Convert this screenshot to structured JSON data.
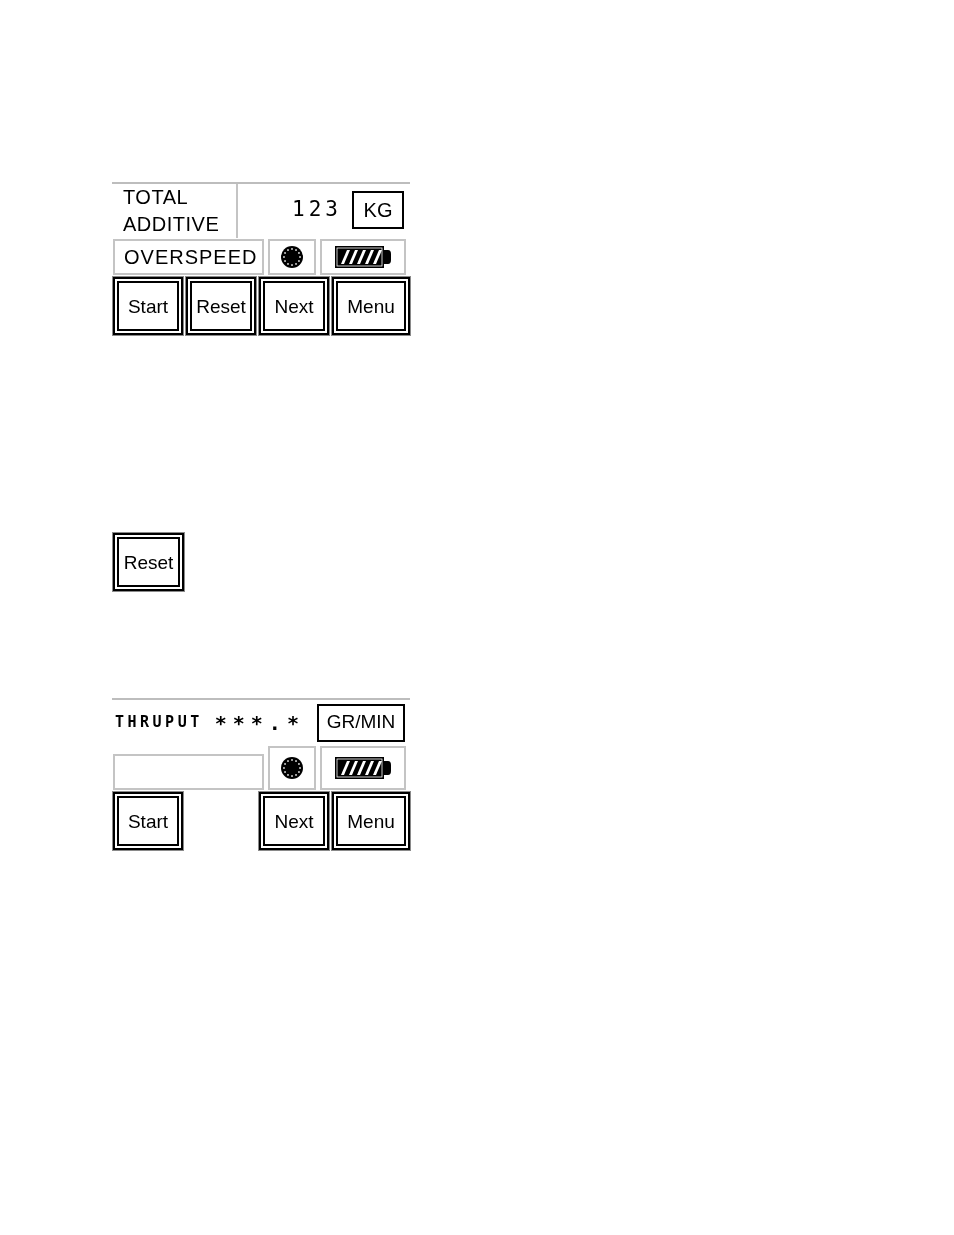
{
  "sections": [
    {
      "kind": "screen",
      "title_boxed": true,
      "title": "TOTAL ADDITIVE",
      "value": "123",
      "unit": "KG",
      "status": "OVERSPEED",
      "buttons": [
        {
          "kind": "button",
          "label": "Start"
        },
        {
          "kind": "button",
          "label": "Reset"
        },
        {
          "kind": "button",
          "label": "Next"
        },
        {
          "kind": "button",
          "label": "Menu"
        }
      ]
    },
    {
      "kind": "button",
      "label": "Reset"
    },
    {
      "kind": "screen",
      "title_boxed": false,
      "title": "THRUPUT",
      "value": "***.*",
      "unit": "GR/MIN",
      "buttons": [
        {
          "kind": "button",
          "label": "Start"
        },
        {
          "kind": "blank"
        },
        {
          "kind": "button",
          "label": "Next"
        },
        {
          "kind": "button",
          "label": "Menu"
        }
      ]
    }
  ]
}
